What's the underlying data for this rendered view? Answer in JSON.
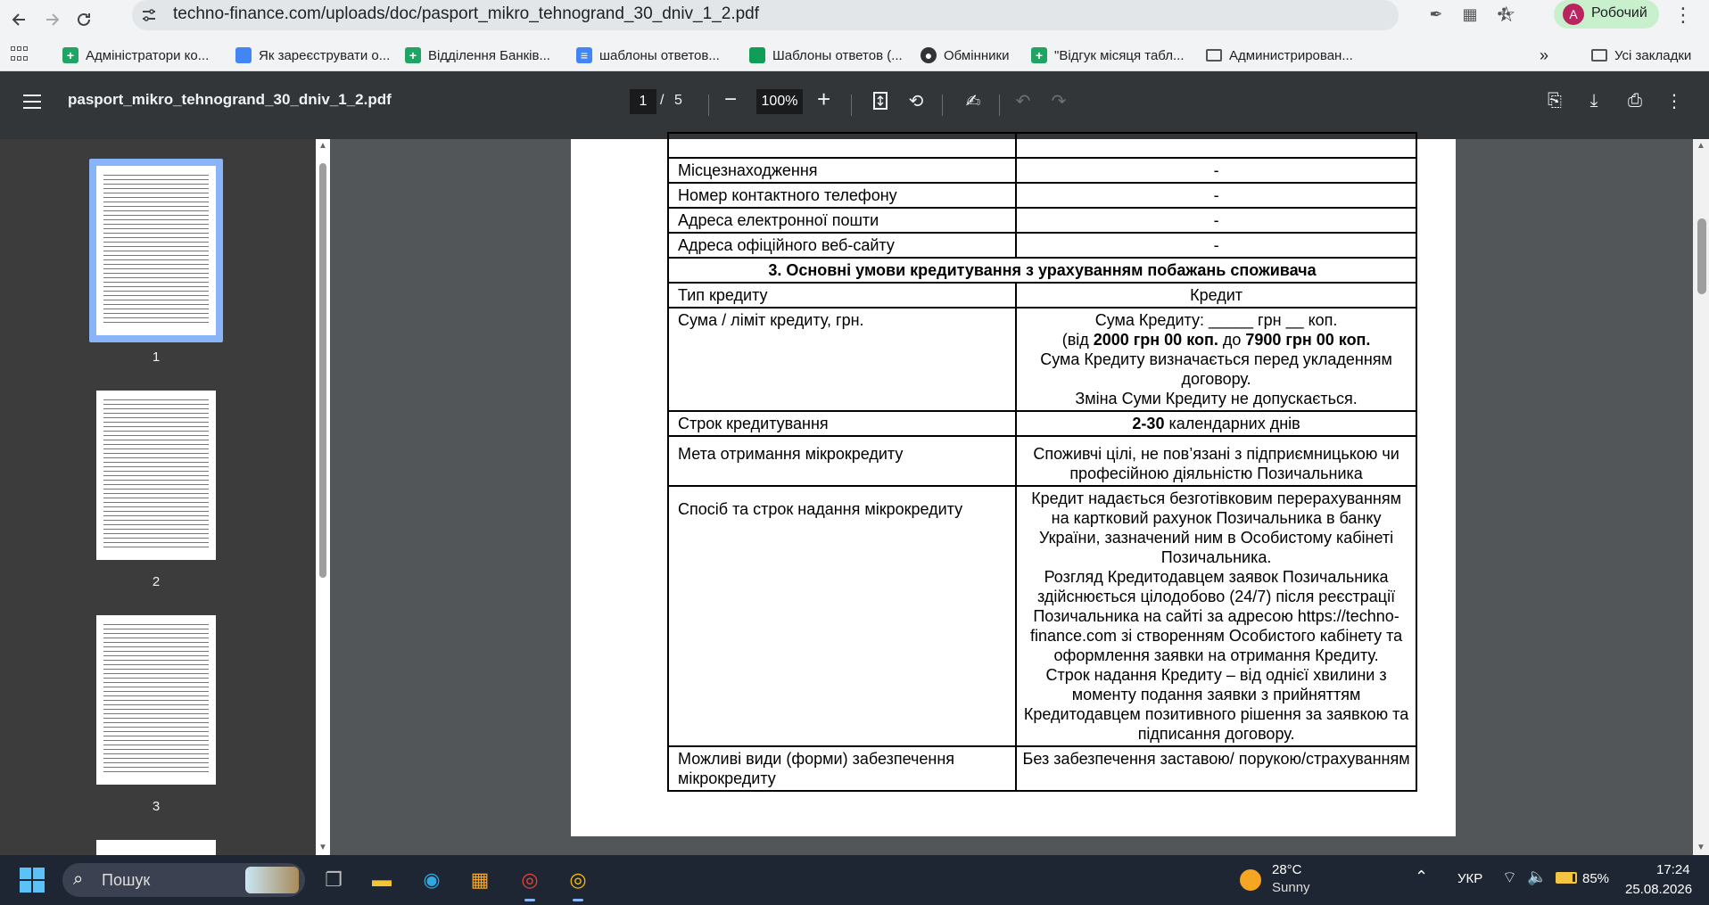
{
  "browser": {
    "url": "techno-finance.com/uploads/doc/pasport_mikro_tehnogrand_30_dniv_1_2.pdf",
    "profile_initial": "A",
    "profile_name": "Робочий"
  },
  "bookmarks": {
    "items": [
      {
        "label": "Адміністратори ко...",
        "icon": "sheets-icon"
      },
      {
        "label": "Як зареєструвати о...",
        "icon": "doc-icon"
      },
      {
        "label": "Відділення Банків...",
        "icon": "sheets-icon"
      },
      {
        "label": "шаблоны ответов...",
        "icon": "docs-icon"
      },
      {
        "label": "Шаблоны ответов (...",
        "icon": "slides-icon"
      },
      {
        "label": "Обмінники",
        "icon": "globe-icon"
      },
      {
        "label": "\"Відгук місяця табл...",
        "icon": "sheets-icon"
      },
      {
        "label": "Администрирован...",
        "icon": "folder-icon"
      }
    ],
    "overflow": "»",
    "all_bookmarks": "Усі закладки"
  },
  "pdf_toolbar": {
    "title": "pasport_mikro_tehnogrand_30_dniv_1_2.pdf",
    "page_current": "1",
    "page_sep": "/",
    "page_total": "5",
    "zoom": "100%"
  },
  "thumbnails": {
    "labels": [
      "1",
      "2",
      "3"
    ],
    "selected_page": 1
  },
  "document": {
    "rows": [
      {
        "left": "Місцезнаходження",
        "right": "-"
      },
      {
        "left": "Номер контактного телефону",
        "right": "-"
      },
      {
        "left": "Адреса електронної пошти",
        "right": "-"
      },
      {
        "left": "Адреса офіційного веб-сайту",
        "right": "-"
      }
    ],
    "section_title": "3. Основні умови кредитування з урахуванням побажань споживача",
    "credit_type_label": "Тип кредиту",
    "credit_type_value": "Кредит",
    "amount_label": "Сума / ліміт кредиту, грн.",
    "amount_line1": "Сума Кредиту: _____ грн __ коп.",
    "amount_line2_pre": "(від ",
    "amount_min": "2000 грн 00 коп.",
    "amount_line2_mid": " до ",
    "amount_max": "7900 грн 00 коп.",
    "amount_line3": "Сума Кредиту визначається перед укладенням договору.",
    "amount_line4": "Зміна Суми Кредиту не допускається.",
    "term_label": "Строк кредитування",
    "term_days": "2-30",
    "term_unit": " календарних днів",
    "purpose_label": "Мета отримання мікрокредиту",
    "purpose_value": "Споживчі цілі, не пов’язані з підприємницькою чи професійною діяльністю Позичальника",
    "method_label": "Спосіб та строк надання мікрокредиту",
    "method_p1": "Кредит надається безготівковим перерахуванням на картковий рахунок Позичальника в банку України, зазначений ним в Особистому кабінеті Позичальника.",
    "method_p2": "Розгляд Кредитодавцем заявок Позичальника здійснюється цілодобово (24/7) після реєстрації Позичальника на сайті за адресою https://techno-finance.com зі створенням Особистого кабінету та оформлення заявки на отримання Кредиту.",
    "method_p3": "Строк надання Кредиту – від однієї хвилини з моменту подання заявки з прийняттям Кредитодавцем позитивного рішення за заявкою та підписання договору.",
    "security_label": "Можливі види (форми) забезпечення мікрокредиту",
    "security_value": "Без забезпечення заставою/ порукою/страхуванням"
  },
  "taskbar": {
    "search_placeholder": "Пошук",
    "weather_temp": "28°C",
    "weather_desc": "Sunny",
    "lang": "УКР",
    "battery": "85%",
    "battery_level": 0.85,
    "time": "17:24",
    "date": "25.08.2026"
  }
}
